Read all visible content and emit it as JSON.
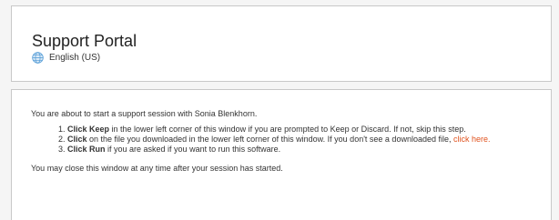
{
  "header": {
    "title": "Support Portal",
    "language": "English (US)",
    "language_icon": "globe-icon"
  },
  "session": {
    "intro": "You are about to start a support session with Sonia Blenkhorn.",
    "steps": [
      {
        "bold": "Click Keep",
        "text": " in the lower left corner of this window if you are prompted to Keep or Discard. If not, skip this step."
      },
      {
        "bold": "Click",
        "text": " on the file you downloaded in the lower left corner of this window. If you don't see a downloaded file, ",
        "link": "click here",
        "after": "."
      },
      {
        "bold": "Click Run",
        "text": " if you are asked if you want to run this software."
      }
    ],
    "closing": "You may close this window at any time after your session has started."
  },
  "colors": {
    "link": "#e0531f",
    "globe": "#5aa0d8"
  }
}
